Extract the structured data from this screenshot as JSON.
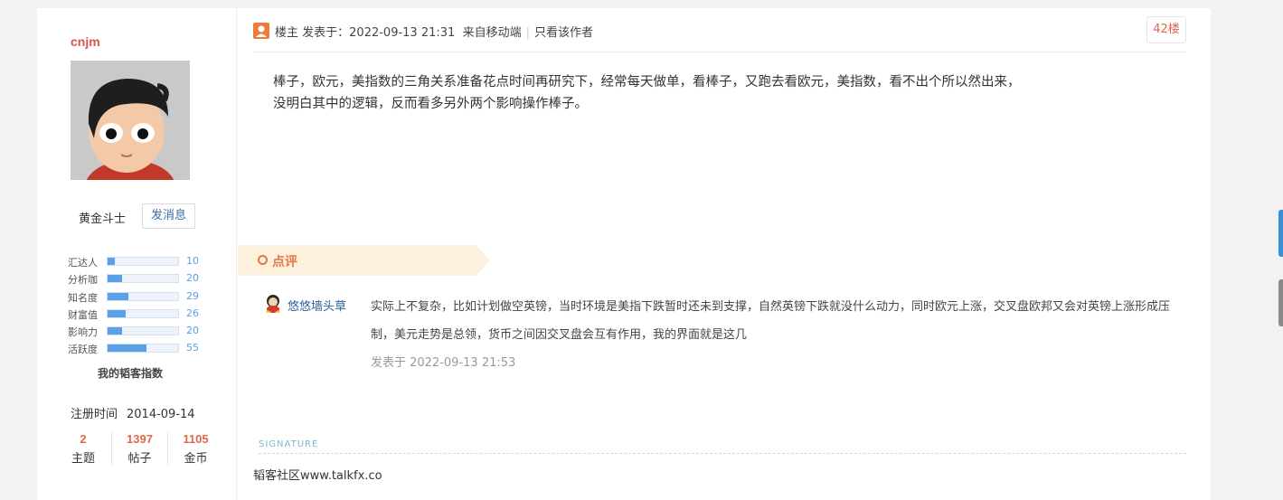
{
  "profile": {
    "username": "cnjm",
    "rank_title": "黄金斗士",
    "send_message": "发消息",
    "index": [
      {
        "label": "汇达人",
        "value": "10",
        "fraction": 0.1
      },
      {
        "label": "分析咖",
        "value": "20",
        "fraction": 0.2
      },
      {
        "label": "知名度",
        "value": "29",
        "fraction": 0.29
      },
      {
        "label": "财富值",
        "value": "26",
        "fraction": 0.26
      },
      {
        "label": "影响力",
        "value": "20",
        "fraction": 0.2
      },
      {
        "label": "活跃度",
        "value": "55",
        "fraction": 0.55
      }
    ],
    "index_title": "我的韬客指数",
    "register_label": "注册时间",
    "register_date": "2014-09-14",
    "stats": [
      {
        "num": "2",
        "label": "主题"
      },
      {
        "num": "1397",
        "label": "帖子"
      },
      {
        "num": "1105",
        "label": "金币"
      }
    ]
  },
  "post": {
    "host_label": "楼主",
    "posted_at": "发表于：2022-09-13 21:31",
    "source": "来自移动端",
    "only_author": "只看该作者",
    "floor": "42楼",
    "content_lines": [
      "棒子，欧元，美指数的三角关系准备花点时间再研究下，经常每天做单，看棒子，又跑去看欧元，美指数，看不出个所以然出来，",
      "没明白其中的逻辑，反而看多另外两个影响操作棒子。"
    ]
  },
  "comment": {
    "header": "点评",
    "user": "悠悠墙头草",
    "text": "实际上不复杂，比如计划做空英镑，当时环境是美指下跌暂时还未到支撑，自然英镑下跌就没什么动力，同时欧元上涨，交叉盘欧邦又会对英镑上涨形成压制，美元走势是总领，货币之间因交叉盘会互有作用，我的界面就是这几",
    "time": "发表于 2022-09-13 21:53"
  },
  "signature": {
    "label": "SIGNATURE",
    "text": "韬客社区www.talkfx.co"
  },
  "colors": {
    "accent": "#e0664c",
    "link": "#2c5f9e",
    "bar": "#5aa0e6",
    "comment_bg": "#fdf0dc"
  }
}
